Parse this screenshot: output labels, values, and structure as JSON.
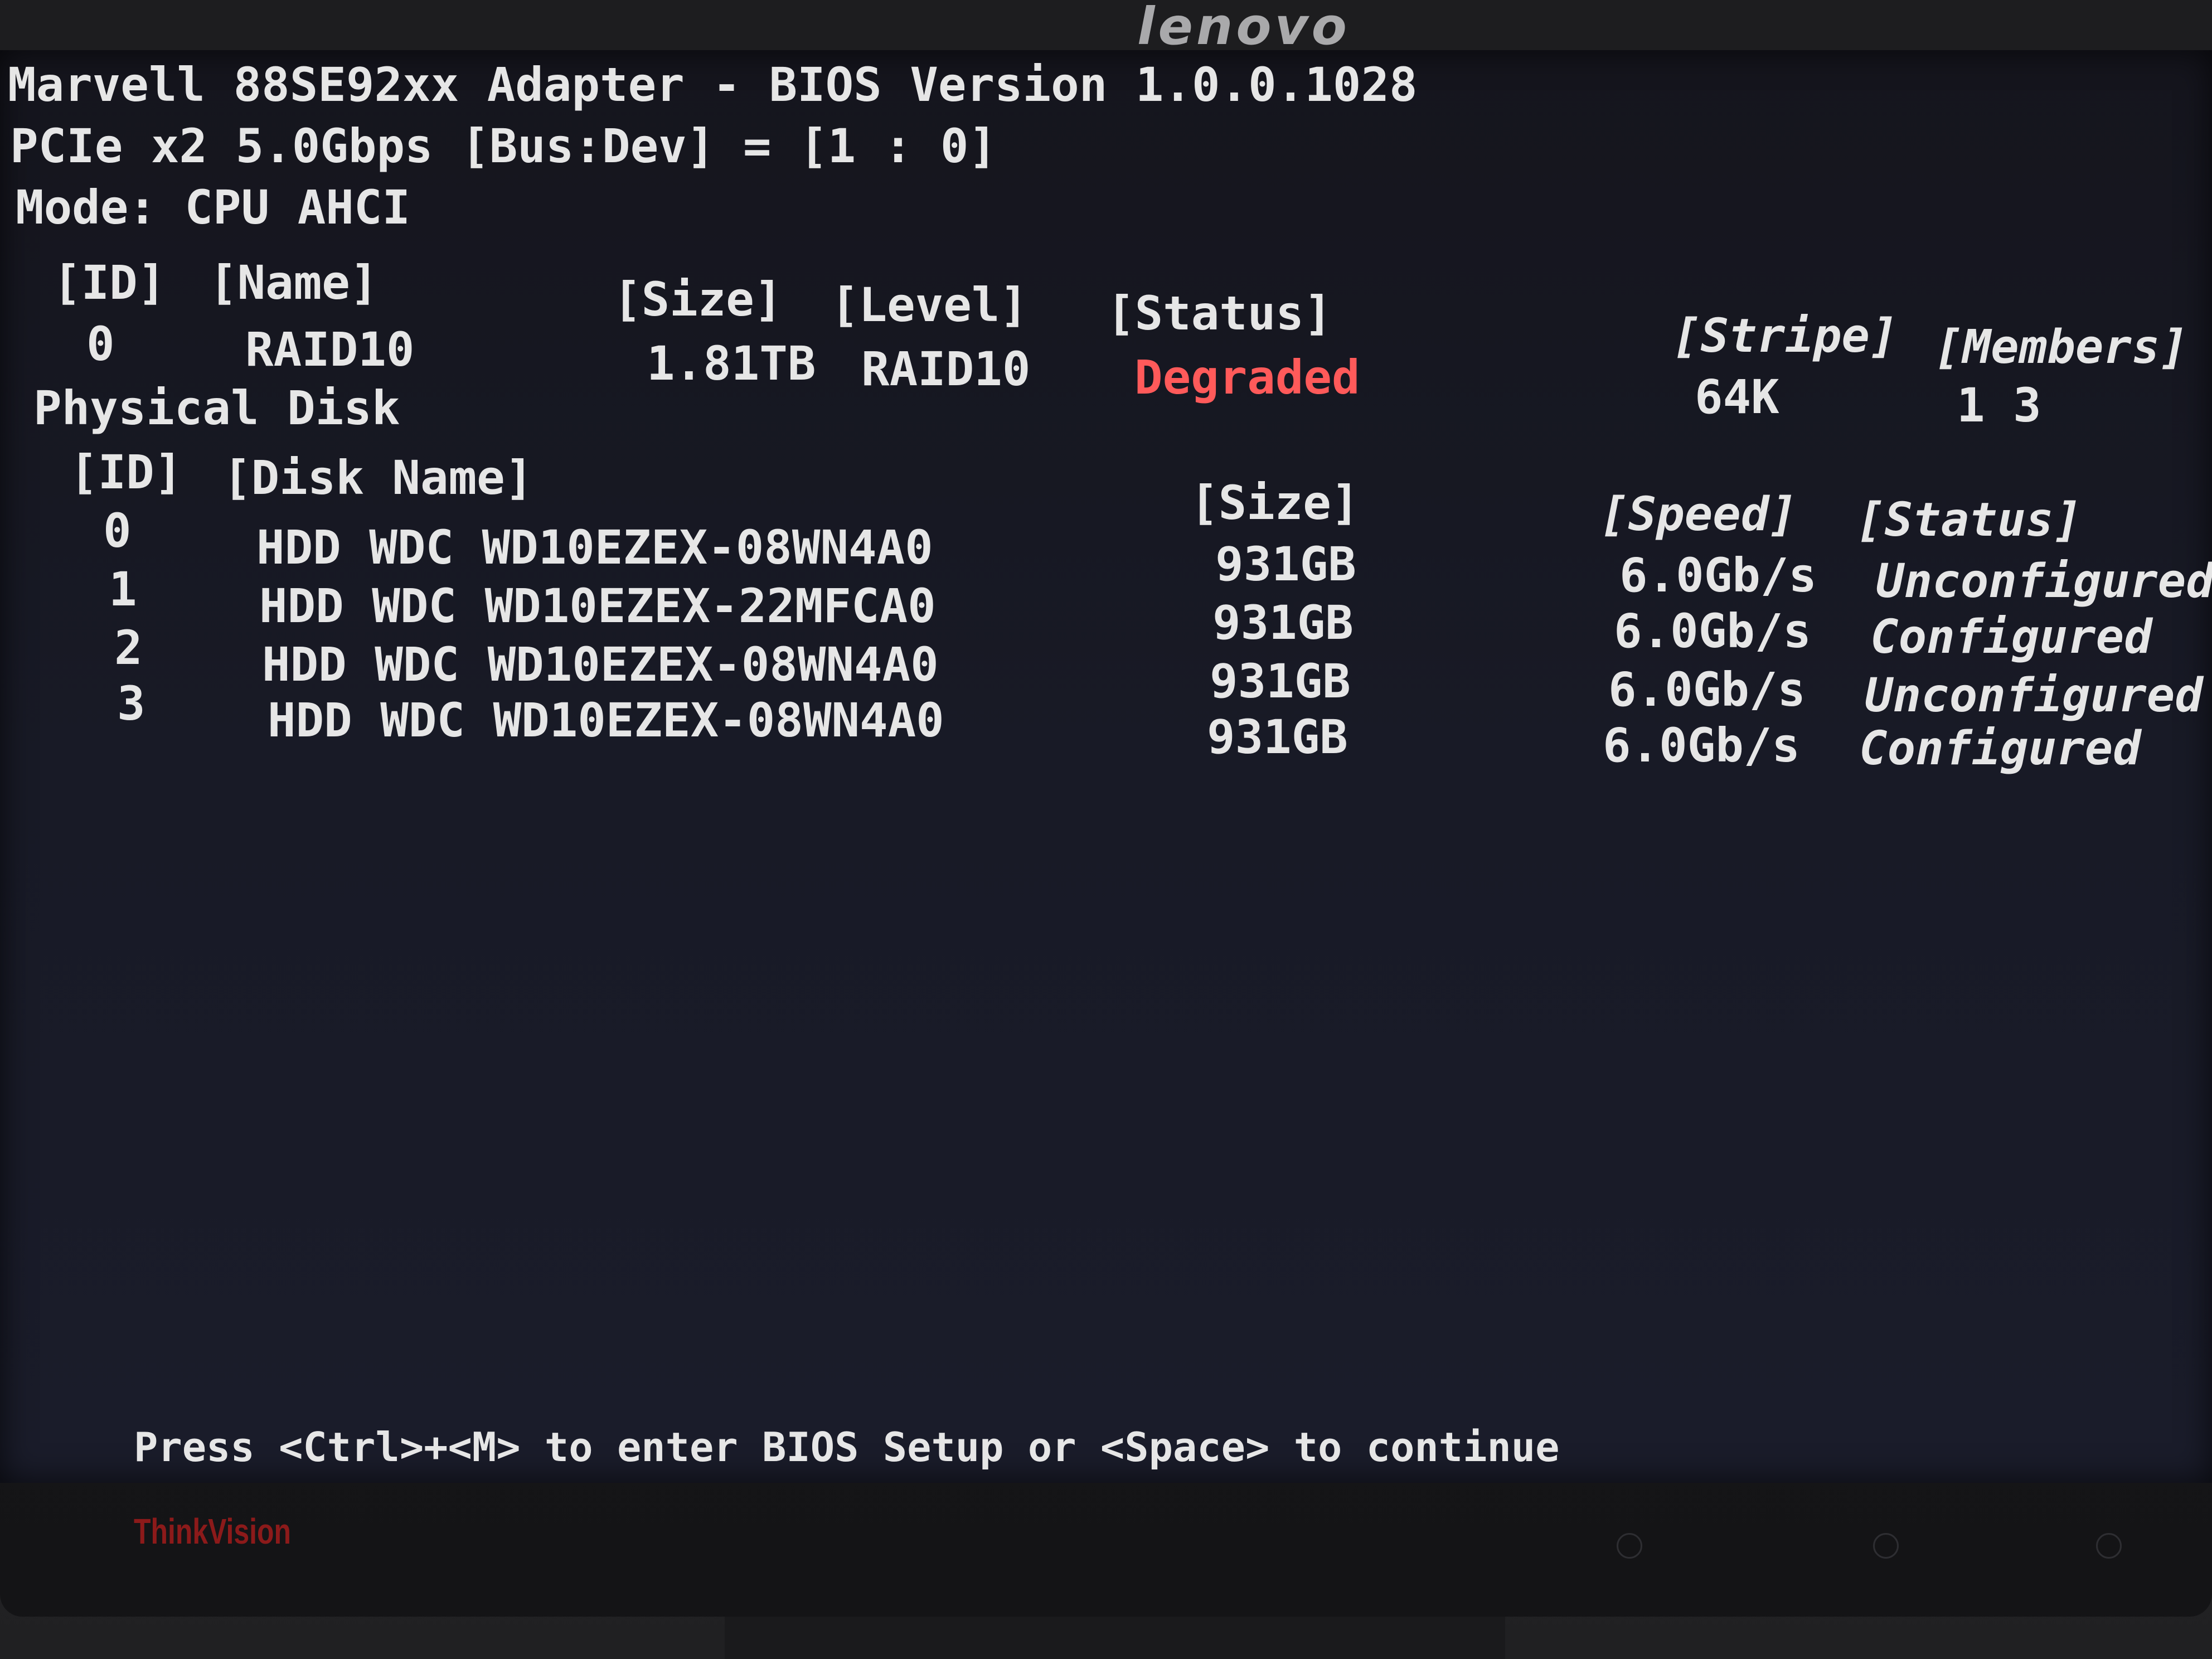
{
  "monitor": {
    "top_brand": "lenovo",
    "bottom_brand": "ThinkVision"
  },
  "bios": {
    "title": "Marvell 88SE92xx Adapter - BIOS Version 1.0.0.1028",
    "bus_line": "PCIe x2 5.0Gbps [Bus:Dev] = [1 : 0]",
    "mode_line": "Mode: CPU AHCI",
    "virtual_disk": {
      "headers": {
        "id": "[ID]",
        "name": "[Name]",
        "size": "[Size]",
        "level": "[Level]",
        "status": "[Status]",
        "stripe": "[Stripe]",
        "members": "[Members]"
      },
      "row": {
        "id": "0",
        "name": "RAID10",
        "size": "1.81TB",
        "level": "RAID10",
        "status": "Degraded",
        "stripe": "64K",
        "members": "1 3"
      },
      "status_color": "#ff5a5a"
    },
    "physical_disk": {
      "section_label": "Physical Disk",
      "headers": {
        "id": "[ID]",
        "disk_name": "[Disk Name]",
        "size": "[Size]",
        "speed": "[Speed]",
        "status": "[Status]"
      },
      "rows": [
        {
          "id": "0",
          "name": "HDD WDC WD10EZEX-08WN4A0",
          "size": "931GB",
          "speed": "6.0Gb/s",
          "status": "Unconfigured"
        },
        {
          "id": "1",
          "name": "HDD WDC WD10EZEX-22MFCA0",
          "size": "931GB",
          "speed": "6.0Gb/s",
          "status": "Configured"
        },
        {
          "id": "2",
          "name": "HDD WDC WD10EZEX-08WN4A0",
          "size": "931GB",
          "speed": "6.0Gb/s",
          "status": "Unconfigured"
        },
        {
          "id": "3",
          "name": "HDD WDC WD10EZEX-08WN4A0",
          "size": "931GB",
          "speed": "6.0Gb/s",
          "status": "Configured"
        }
      ]
    },
    "footer_prompt": "Press <Ctrl>+<M> to enter BIOS Setup or <Space> to continue"
  }
}
